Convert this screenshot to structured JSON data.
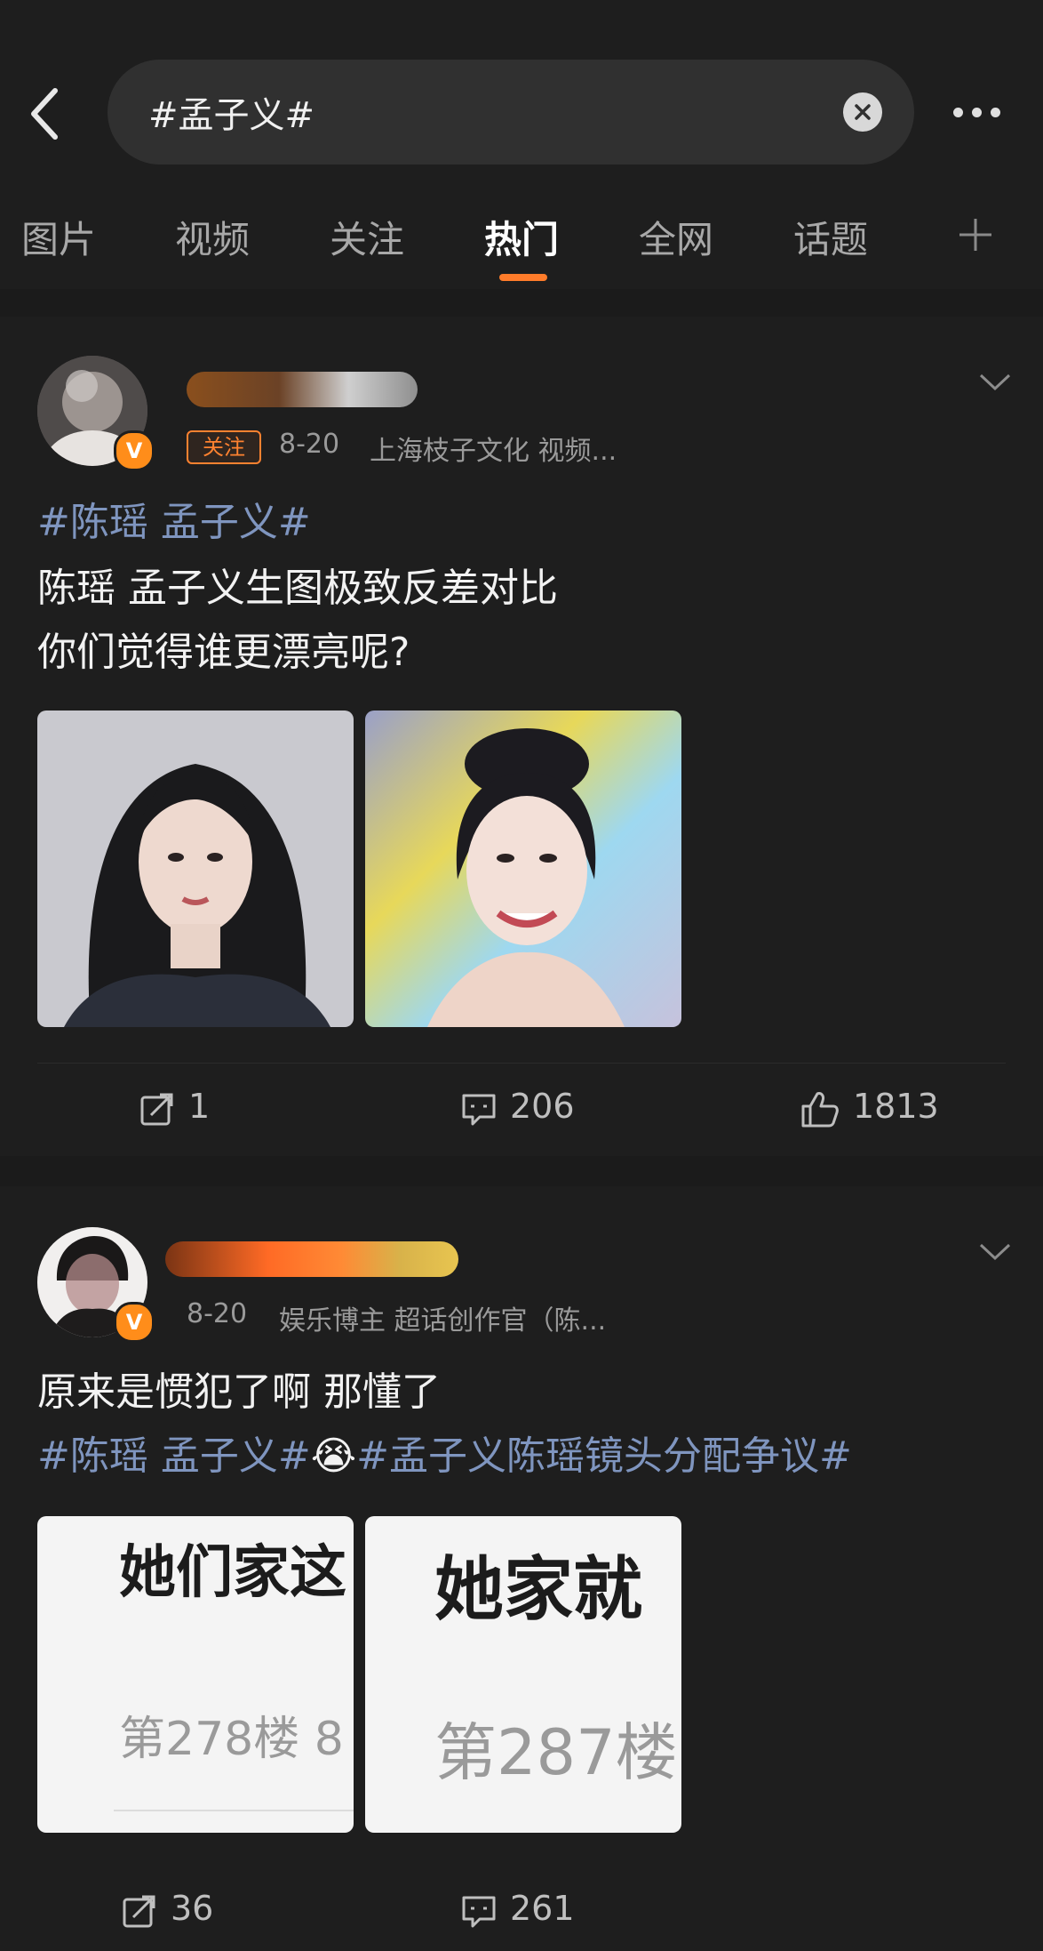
{
  "search": {
    "query": "#孟子义#"
  },
  "tabs": [
    "图片",
    "视频",
    "关注",
    "热门",
    "全网",
    "话题"
  ],
  "active_tab": "热门",
  "posts": [
    {
      "follow_label": "关注",
      "date": "8-20",
      "source": "上海枝子文化 视频...",
      "hashtag_line": "#陈瑶 孟子义#",
      "text_line_1": "陈瑶  孟子义生图极致反差对比",
      "text_line_2": "你们觉得谁更漂亮呢?",
      "reposts": "1",
      "comments": "206",
      "likes": "1813"
    },
    {
      "date": "8-20",
      "meta": "娱乐博主 超话创作官（陈...",
      "text_line_1": "原来是惯犯了啊 那懂了",
      "hashtag_1": "#陈瑶 孟子义#",
      "emoji": "😭",
      "hashtag_2": "#孟子义陈瑶镜头分配争议#",
      "image_1": {
        "title": "她们家这",
        "subtitle": "第278楼 8"
      },
      "image_2": {
        "title": "她家就",
        "subtitle": "第287楼"
      },
      "reposts": "36",
      "comments": "261"
    }
  ],
  "colors": {
    "accent": "#ff7c2a",
    "hashtag": "#7f95bf",
    "verified": "#ff8d1a"
  }
}
